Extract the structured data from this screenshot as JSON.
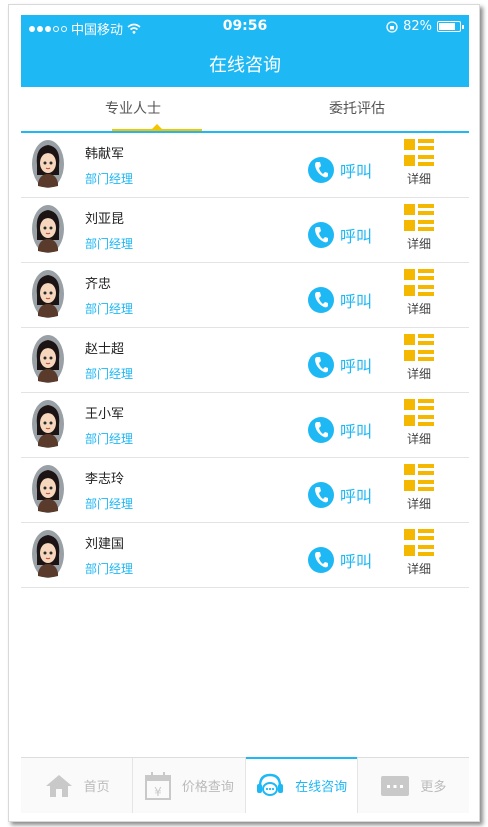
{
  "status_bar": {
    "carrier": "中国移动",
    "time": "09:56",
    "battery": "82%",
    "battery_level": 0.82
  },
  "header": {
    "title": "在线咨询"
  },
  "tabs": [
    {
      "label": "专业人士",
      "active": true
    },
    {
      "label": "委托评估",
      "active": false
    }
  ],
  "contacts": [
    {
      "name": "韩献军",
      "role": "部门经理",
      "call_label": "呼叫",
      "detail_label": "详细"
    },
    {
      "name": "刘亚昆",
      "role": "部门经理",
      "call_label": "呼叫",
      "detail_label": "详细"
    },
    {
      "name": "齐忠",
      "role": "部门经理",
      "call_label": "呼叫",
      "detail_label": "详细"
    },
    {
      "name": "赵士超",
      "role": "部门经理",
      "call_label": "呼叫",
      "detail_label": "详细"
    },
    {
      "name": "王小军",
      "role": "部门经理",
      "call_label": "呼叫",
      "detail_label": "详细"
    },
    {
      "name": "李志玲",
      "role": "部门经理",
      "call_label": "呼叫",
      "detail_label": "详细"
    },
    {
      "name": "刘建国",
      "role": "部门经理",
      "call_label": "呼叫",
      "detail_label": "详细"
    }
  ],
  "bottom_nav": [
    {
      "label": "首页",
      "icon": "home-icon",
      "active": false
    },
    {
      "label": "价格查询",
      "icon": "price-calendar-icon",
      "active": false
    },
    {
      "label": "在线咨询",
      "icon": "headset-chat-icon",
      "active": true
    },
    {
      "label": "更多",
      "icon": "more-icon",
      "active": false
    }
  ],
  "colors": {
    "accent": "#1EB8F5",
    "highlight": "#F5C400",
    "detail_icon": "#F5B800"
  }
}
